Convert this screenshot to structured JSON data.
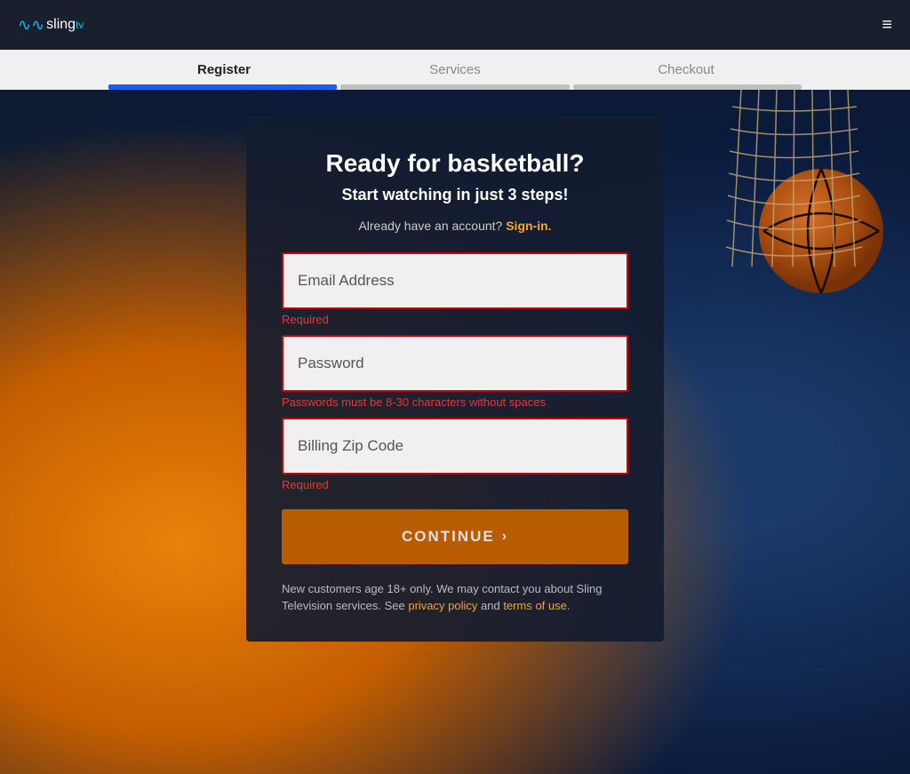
{
  "navbar": {
    "logo": "sling",
    "logo_suffix": "tv",
    "hamburger_label": "≡"
  },
  "steps": {
    "step1": {
      "label": "Register",
      "active": true,
      "filled": true
    },
    "step2": {
      "label": "Services",
      "active": false,
      "filled": false
    },
    "step3": {
      "label": "Checkout",
      "active": false,
      "filled": false
    }
  },
  "form": {
    "headline": "Ready for basketball?",
    "subheadline": "Start watching in just 3 steps!",
    "already_account_text": "Already have an account?",
    "sign_in_label": "Sign-in.",
    "email_placeholder": "Email Address",
    "email_error": "Required",
    "password_placeholder": "Password",
    "password_note": "Passwords must be 8-30 characters without spaces",
    "zip_placeholder": "Billing Zip Code",
    "zip_error": "Required",
    "continue_label": "CONTINUE",
    "fine_print_1": "New customers age 18+ only. We may contact you about Sling Television services. See",
    "privacy_policy_label": "privacy policy",
    "fine_print_2": "and",
    "terms_label": "terms of use."
  }
}
